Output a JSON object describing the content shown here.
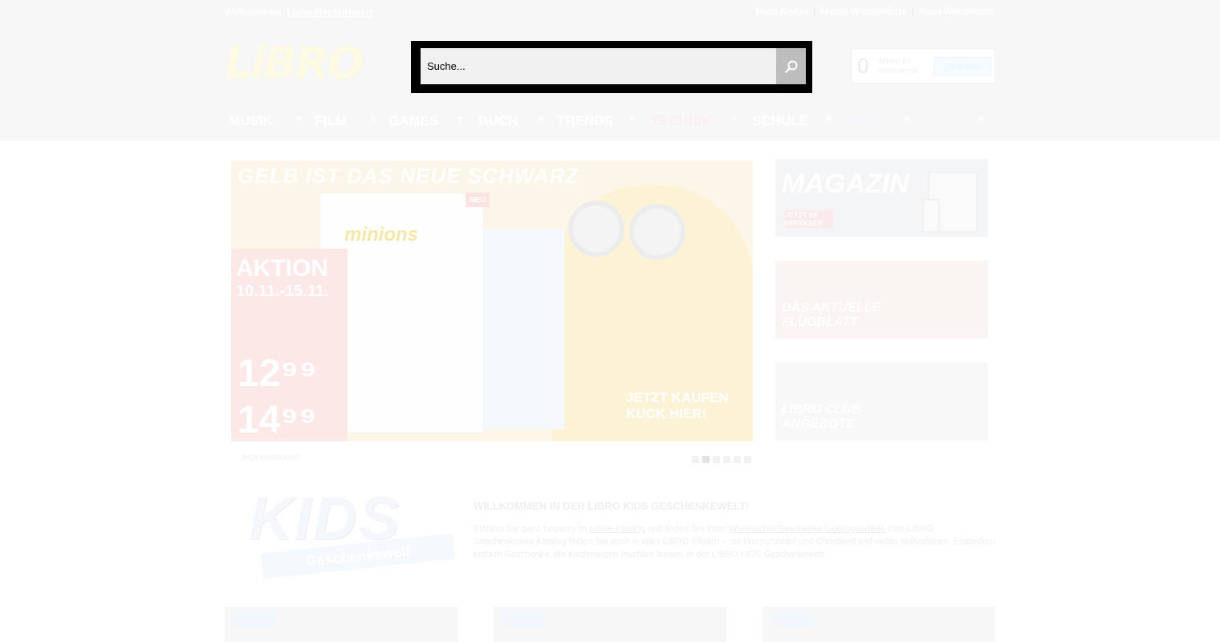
{
  "topbar": {
    "welcome": "Willkommen,",
    "login": "Login/Registrieren",
    "links": [
      "Mein Konto",
      "Meine Wunschliste",
      "Mein Warenkorb"
    ],
    "separator": "|"
  },
  "logo": {
    "text": "LiBRO"
  },
  "search": {
    "placeholder": "Suche...",
    "value": ""
  },
  "cart": {
    "count": "0",
    "label": "Artikel im Warenkorb",
    "button": "Zur Kasse"
  },
  "nav": {
    "items": [
      {
        "label": "MUSIK"
      },
      {
        "label": "FILM"
      },
      {
        "label": "GAMES"
      },
      {
        "label": "BUCH"
      },
      {
        "label": "TRENDS"
      },
      {
        "label": "TECHNIK"
      },
      {
        "label": "SCHULE"
      },
      {
        "label": "BÜRO"
      },
      {
        "label": "TOYS"
      }
    ],
    "arrow": "▼"
  },
  "banner": {
    "slogan": "GELB IST DAS NEUE SCHWARZ",
    "neu": "NEU",
    "book_brand": "minions",
    "aktion": "AKTION",
    "dates": "10.11.-15.11.",
    "price1": "12⁹⁹",
    "price2": "14⁹⁹",
    "cta": "JETZT KAUFEN KUCK HIER!"
  },
  "slider": {
    "caption": "Jetzt entdecken!",
    "dots": 6,
    "active": 1
  },
  "side": {
    "magazin": "MAGAZIN",
    "magazin_btn": "JETZT IM BROWSER",
    "flugblatt": "DAS AKTUELLE FLUGBLATT",
    "club": "LIBRO CLUB ANGEBOTE"
  },
  "kids": {
    "word": "KIDS",
    "band": "Geschenkewelt"
  },
  "welcome": {
    "title": "WILLKOMMEN IN DER LIBRO KIDS GESCHENKEWELT!",
    "p1": "Blättern Sie ganz bequem im",
    "link1": "online Katalog",
    "p2": "und finden Sie Ihren",
    "link2": "Weihnachts Geschenke Lieblingsartikel.",
    "p3": "Den LIBRO Geschenkewelt Katalog finden Sie auch in allen LIBRO Filialen – mit Wunschzettel und Christkind und vielen Malvorlagen. Entdecken einfach Geschenke, die Kinderaugen leuchten lassen, in der LIBRO KIDS Geschenkewelt."
  },
  "colors": {
    "search_frame": "#000000",
    "search_btn": "#bdbdbd",
    "header_bg": "#f7f7f7"
  }
}
